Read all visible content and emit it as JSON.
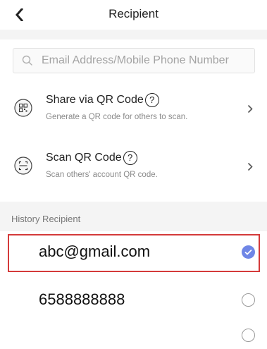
{
  "header": {
    "title": "Recipient"
  },
  "search": {
    "placeholder": "Email Address/Mobile Phone Number"
  },
  "actions": [
    {
      "title": "Share via QR Code",
      "subtitle": "Generate a QR code for others to scan.",
      "icon": "qr-code-icon"
    },
    {
      "title": "Scan QR Code",
      "subtitle": "Scan others' account QR code.",
      "icon": "scan-icon"
    }
  ],
  "help_glyph": "?",
  "history": {
    "label": "History Recipient",
    "items": [
      {
        "value": "abc@gmail.com",
        "selected": true
      },
      {
        "value": "6588888888",
        "selected": false
      },
      {
        "value": "",
        "selected": false
      }
    ]
  },
  "colors": {
    "accent": "#6f86e6",
    "highlight_border": "#d43a3a",
    "separator": "#f4f4f4"
  }
}
